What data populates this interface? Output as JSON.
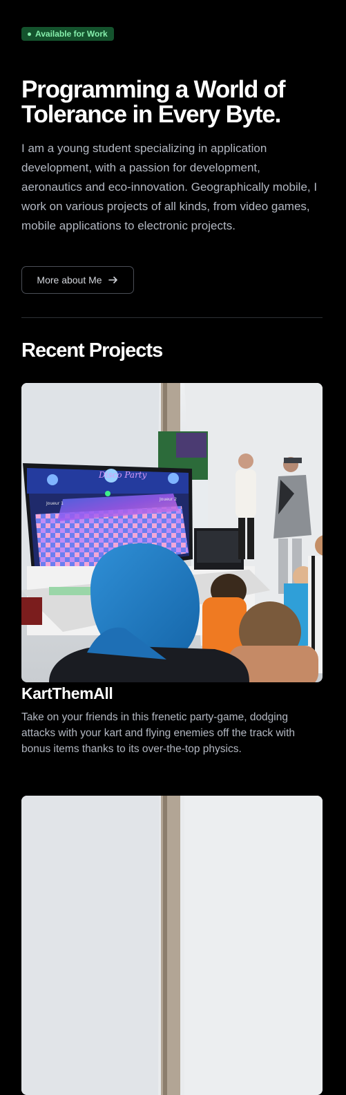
{
  "hero": {
    "badge_label": "Available for Work",
    "title": "Programming a World of Tolerance in Every Byte.",
    "description": "I am a young student specializing in application development, with a passion for development, aeronautics and eco-innovation. Geographically mobile, I work on various projects of all kinds, from video games, mobile applications to electronic projects.",
    "more_button_label": "More about Me",
    "more_button_icon": "arrow-right-icon"
  },
  "projects": {
    "section_title": "Recent Projects",
    "items": [
      {
        "name": "KartThemAll",
        "description": "Take on your friends in this frenetic party-game, dodging attacks with your kart and flying enemies off the track with bonus items thanks to its over-the-top physics.",
        "image_sign": "Disco Party",
        "image_left_label": "Joueur 1",
        "image_right_label": "Joueur 2",
        "image_banner": "Cpt"
      },
      {
        "name": "",
        "description": ""
      }
    ]
  },
  "colors": {
    "background": "#000000",
    "badge_bg": "#14532d",
    "badge_text": "#86efac",
    "body_text": "#b3b8c2",
    "border": "#4b4f57"
  }
}
